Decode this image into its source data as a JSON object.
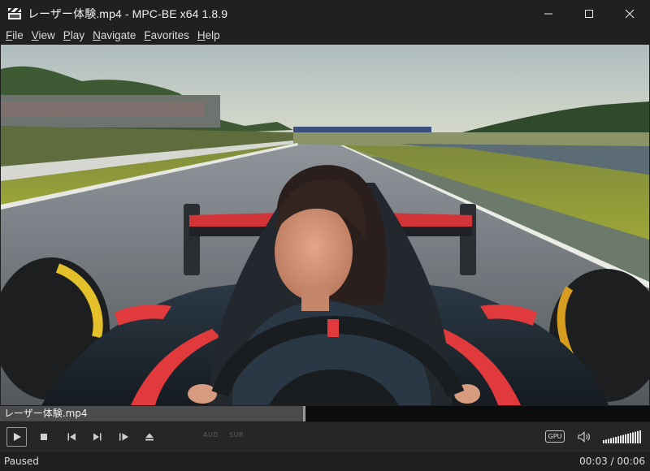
{
  "window": {
    "title": "レーザー体験.mp4 - MPC-BE x64 1.8.9",
    "app_icon": "clapperboard-icon",
    "controls": [
      "minimize-icon",
      "maximize-icon",
      "close-icon"
    ]
  },
  "menu": {
    "items": [
      {
        "mnemonic": "F",
        "rest": "ile"
      },
      {
        "mnemonic": "V",
        "rest": "iew"
      },
      {
        "mnemonic": "P",
        "rest": "lay"
      },
      {
        "mnemonic": "N",
        "rest": "avigate"
      },
      {
        "mnemonic": "F",
        "rest": "avorites"
      },
      {
        "mnemonic": "H",
        "rest": "elp"
      }
    ]
  },
  "seek": {
    "file_title": "レーザー体験.mp4",
    "position_fraction": 0.5
  },
  "controls": {
    "buttons": [
      "play-icon",
      "stop-icon",
      "previous-icon",
      "next-icon",
      "frame-step-icon",
      "eject-icon"
    ],
    "audio_indicator": "AUD",
    "subtitle_indicator": "SUB",
    "gpu_label": "GPU",
    "volume_level": 1.0
  },
  "status": {
    "state": "Paused",
    "time": "00:03 / 00:06"
  },
  "colors": {
    "background": "#202020",
    "seek_fill": "#4b4b4b",
    "car_red": "#e03a3c"
  }
}
